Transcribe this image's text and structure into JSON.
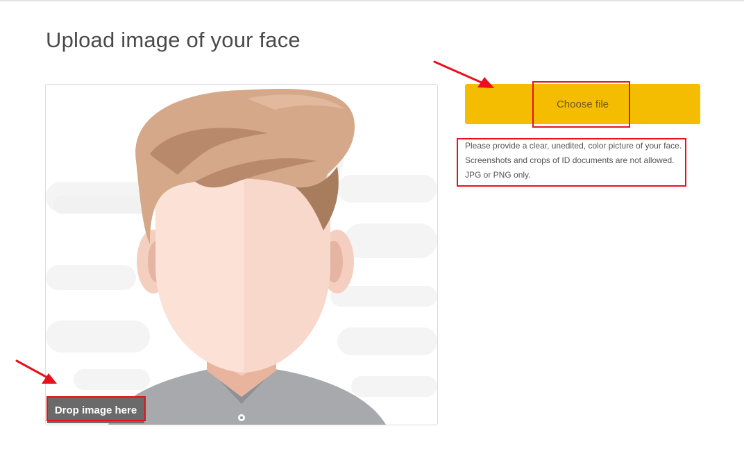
{
  "page": {
    "title": "Upload image of your face"
  },
  "dropzone": {
    "label": "Drop image here"
  },
  "upload": {
    "choose_label": "Choose file",
    "help_text": "Please provide a clear, unedited, color picture of your face. Screenshots and crops of ID documents are not allowed. JPG or PNG only."
  },
  "colors": {
    "accent": "#f5bd02",
    "highlight": "#e8101b"
  },
  "icons": {
    "placeholder": "face-placeholder-icon",
    "annotation": "red-arrow-icon"
  }
}
